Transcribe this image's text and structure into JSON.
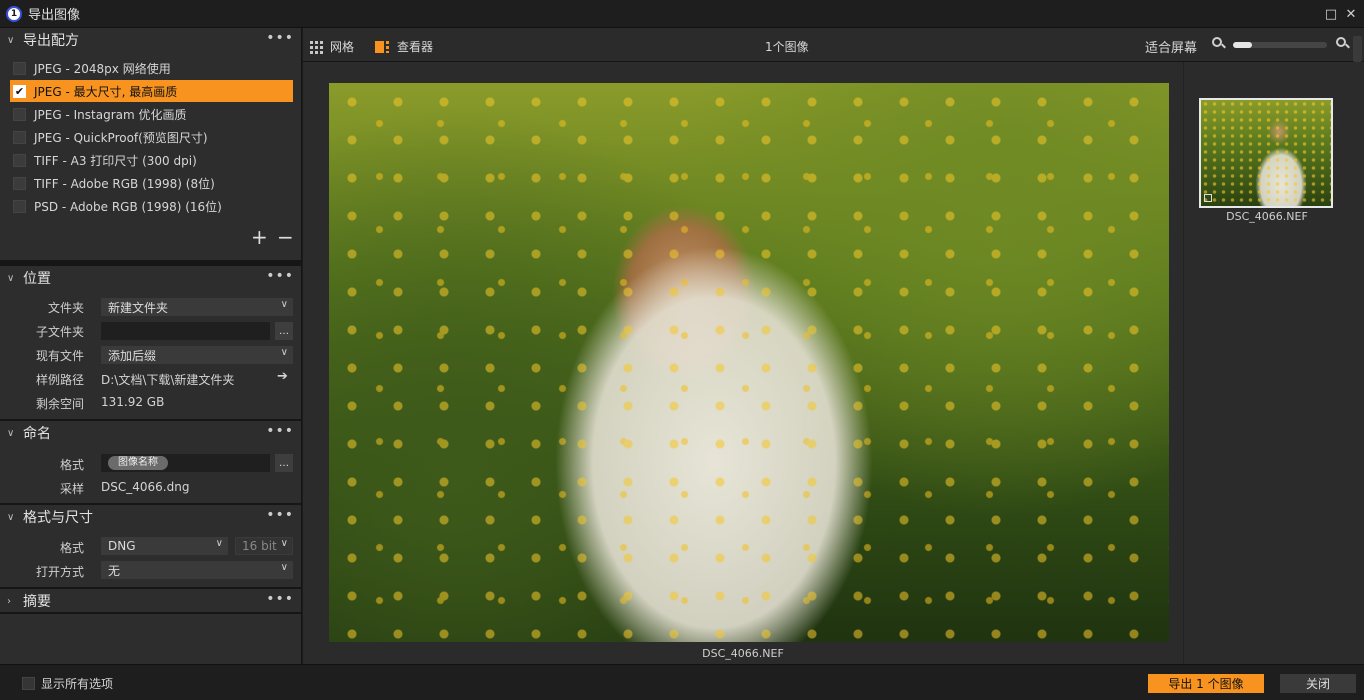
{
  "window": {
    "title": "导出图像",
    "logo_text": "1",
    "maximize_icon": "□",
    "close_icon": "✕"
  },
  "recipes": {
    "title": "导出配方",
    "items": [
      {
        "label": "JPEG - 2048px 网络使用",
        "checked": false
      },
      {
        "label": "JPEG - 最大尺寸, 最高画质",
        "checked": true
      },
      {
        "label": "JPEG - Instagram 优化画质",
        "checked": false
      },
      {
        "label": "JPEG - QuickProof(预览图尺寸)",
        "checked": false
      },
      {
        "label": "TIFF - A3 打印尺寸 (300 dpi)",
        "checked": false
      },
      {
        "label": "TIFF - Adobe RGB (1998) (8位)",
        "checked": false
      },
      {
        "label": "PSD - Adobe RGB (1998) (16位)",
        "checked": false
      }
    ],
    "add_label": "+",
    "remove_label": "−"
  },
  "location": {
    "title": "位置",
    "folder_label": "文件夹",
    "folder_value": "新建文件夹",
    "subfolder_label": "子文件夹",
    "subfolder_value": "",
    "existing_label": "现有文件",
    "existing_value": "添加后缀",
    "sample_path_label": "样例路径",
    "sample_path_value": "D:\\文档\\下载\\新建文件夹",
    "free_space_label": "剩余空间",
    "free_space_value": "131.92 GB"
  },
  "naming": {
    "title": "命名",
    "format_label": "格式",
    "format_token": "图像名称",
    "sample_label": "采样",
    "sample_value": "DSC_4066.dng"
  },
  "format_size": {
    "title": "格式与尺寸",
    "format_label": "格式",
    "format_value": "DNG",
    "bit_value": "16 bit",
    "open_with_label": "打开方式",
    "open_with_value": "无"
  },
  "summary": {
    "title": "摘要"
  },
  "toolbar": {
    "grid_label": "网格",
    "viewer_label": "查看器",
    "count_label": "1个图像",
    "fit_label": "适合屏幕",
    "zoom_fraction": 0.2
  },
  "viewer": {
    "filename": "DSC_4066.NEF"
  },
  "thumbnails": [
    {
      "filename": "DSC_4066.NEF"
    }
  ],
  "footer": {
    "show_all_label": "显示所有选项",
    "export_button": "导出 1 个图像",
    "close_button": "关闭"
  },
  "colors": {
    "accent": "#f7931e",
    "panel": "#2d2d2d",
    "background": "#1b1b1b"
  },
  "icons": {
    "more": "more-dots-icon",
    "grid": "grid-icon",
    "viewer": "viewer-icon",
    "zoom_out": "zoom-out-icon",
    "zoom_in": "zoom-in-icon",
    "arrow": "arrow-right-icon"
  }
}
